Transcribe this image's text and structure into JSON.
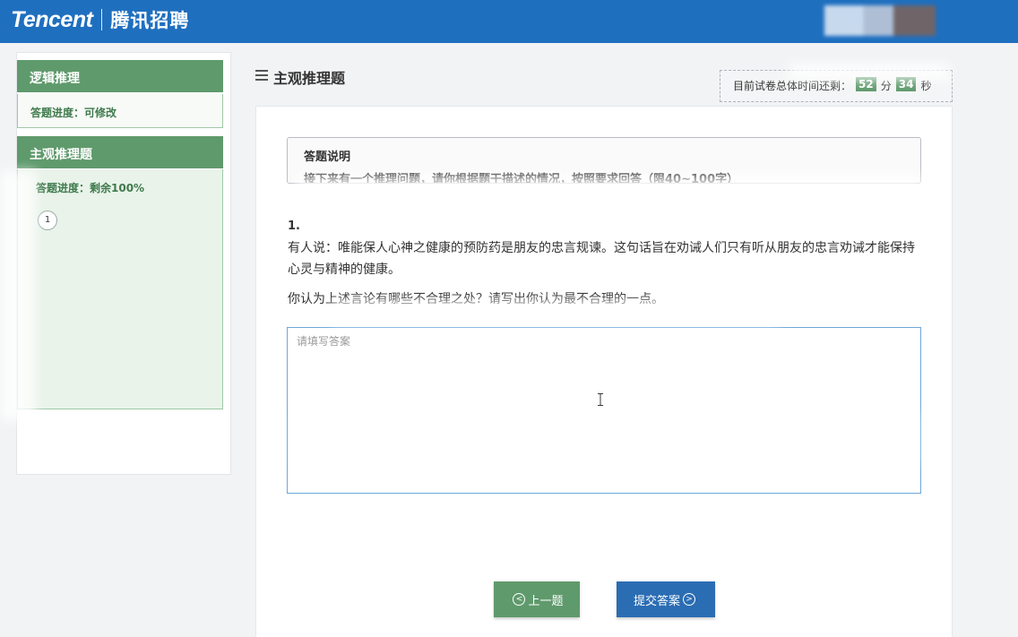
{
  "header": {
    "brand": "Tencent",
    "brand_cn": "腾讯招聘"
  },
  "sidebar": {
    "sections": [
      {
        "title": "逻辑推理",
        "progress": "答题进度：可修改"
      },
      {
        "title": "主观推理题",
        "progress": "答题进度：剩余100%",
        "questions": [
          "1"
        ]
      }
    ]
  },
  "page": {
    "title": "主观推理题",
    "timer": {
      "prefix": "目前试卷总体时间还剩：",
      "minutes": "52",
      "minutes_unit": "分",
      "seconds": "34",
      "seconds_unit": "秒"
    }
  },
  "instructions": {
    "title": "答题说明",
    "text": "接下来有一个推理问题，请你根据题干描述的情况，按照要求回答（限40~100字）"
  },
  "question": {
    "index": "1.",
    "text": "有人说：唯能保人心神之健康的预防药是朋友的忠言规谏。这句话旨在劝诫人们只有听从朋友的忠言劝诫才能保持心灵与精神的健康。",
    "prompt": "你认为上述言论有哪些不合理之处？请写出你认为最不合理的一点。",
    "answer_placeholder": "请填写答案",
    "answer_value": ""
  },
  "buttons": {
    "prev": "上一题",
    "submit": "提交答案"
  },
  "colors": {
    "header_blue": "#1f6fbf",
    "accent_green": "#5f9a6c",
    "submit_blue": "#2b6db3"
  }
}
